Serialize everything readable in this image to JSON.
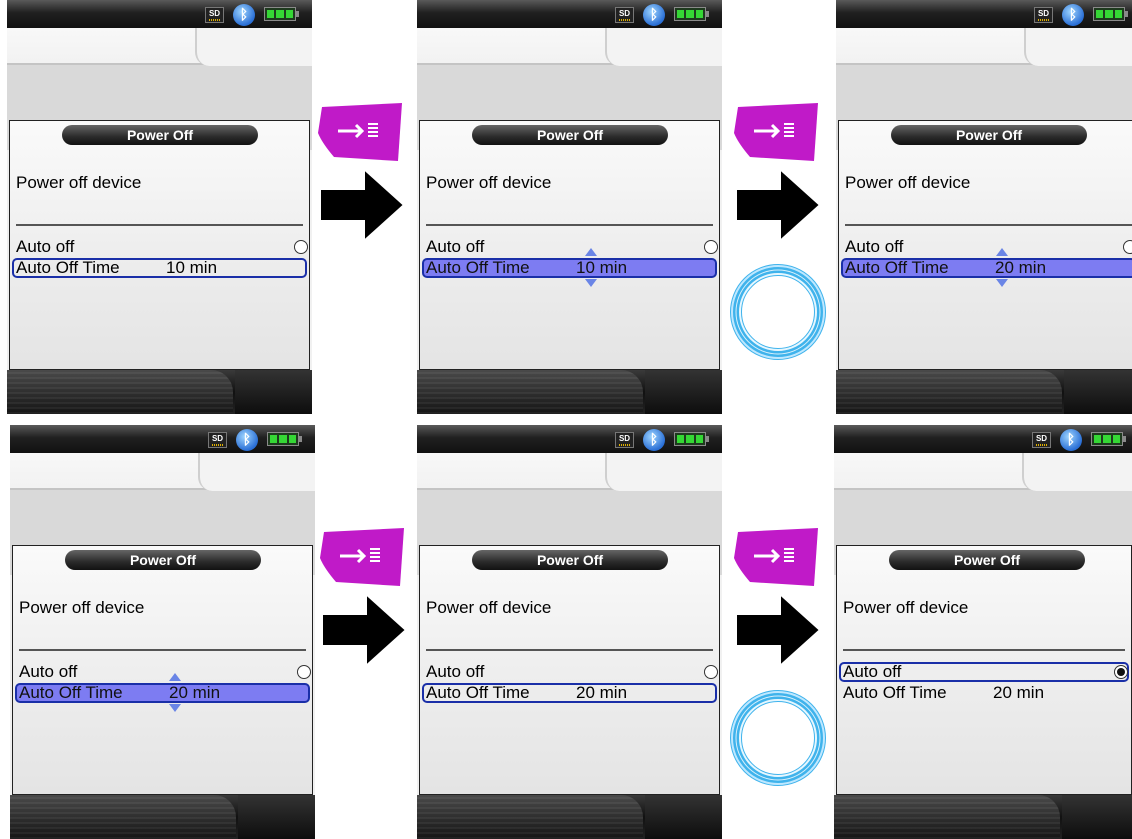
{
  "screens": [
    {
      "title": "Power Off",
      "heading": "Power off device",
      "auto_off_label": "Auto off",
      "time_label": "Auto Off Time",
      "time_value": "10 min",
      "sd": "SD"
    },
    {
      "title": "Power Off",
      "heading": "Power off device",
      "auto_off_label": "Auto off",
      "time_label": "Auto Off Time",
      "time_value": "10 min",
      "sd": "SD"
    },
    {
      "title": "Power Off",
      "heading": "Power off device",
      "auto_off_label": "Auto off",
      "time_label": "Auto Off Time",
      "time_value": "20 min",
      "sd": "SD"
    },
    {
      "title": "Power Off",
      "heading": "Power off device",
      "auto_off_label": "Auto off",
      "time_label": "Auto Off Time",
      "time_value": "20 min",
      "sd": "SD"
    },
    {
      "title": "Power Off",
      "heading": "Power off device",
      "auto_off_label": "Auto off",
      "time_label": "Auto Off Time",
      "time_value": "20 min",
      "sd": "SD"
    },
    {
      "title": "Power Off",
      "heading": "Power off device",
      "auto_off_label": "Auto off",
      "time_label": "Auto Off Time",
      "time_value": "20 min",
      "sd": "SD"
    }
  ],
  "colors": {
    "key_magenta": "#c01ac8",
    "highlight": "#7d7cf2",
    "frame": "#1a2fa8",
    "ring": "#3fb3ec"
  },
  "icons": [
    "sd-card-icon",
    "bluetooth-icon",
    "battery-icon",
    "enter-key-icon",
    "right-arrow-icon",
    "rotary-wheel-icon"
  ]
}
